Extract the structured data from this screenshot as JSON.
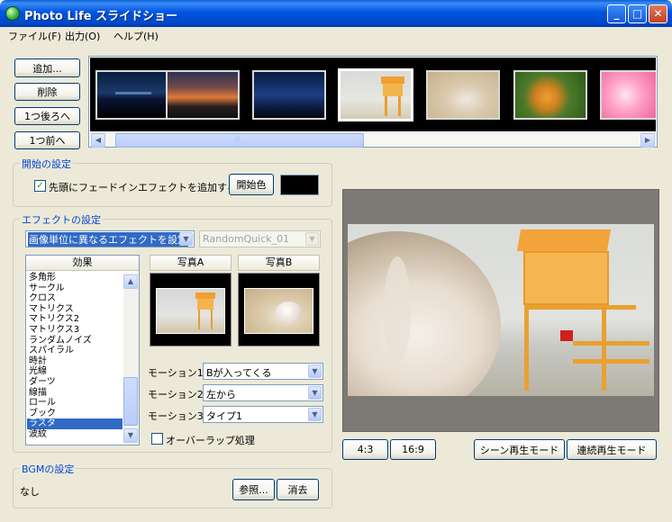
{
  "window": {
    "title": "Photo Life スライドショー",
    "min_label": "_",
    "max_label": "□",
    "close_label": "✕"
  },
  "menu": {
    "file": "ファイル(F)",
    "output": "出力(O)",
    "help": "ヘルプ(H)"
  },
  "side_buttons": {
    "add": "追加...",
    "delete": "削除",
    "move_back": "1つ後ろへ",
    "move_front": "1つ前へ"
  },
  "filmstrip": {
    "thumbnails": [
      {
        "name": "night-harbor"
      },
      {
        "name": "sunset-clouds"
      },
      {
        "name": "night-sky"
      },
      {
        "name": "lifeguard-tower",
        "selected": true
      },
      {
        "name": "seashell-sand"
      },
      {
        "name": "coconuts"
      },
      {
        "name": "hibiscus"
      }
    ],
    "scroll_left_icon": "scroll-left-arrow",
    "scroll_right_icon": "scroll-right-arrow",
    "grip": "⦙⦙⦙"
  },
  "start_settings": {
    "title": "開始の設定",
    "fade_in_checked": true,
    "fade_in_label": "先頭にフェードインエフェクトを追加する",
    "start_color_button": "開始色",
    "start_color": "#000000"
  },
  "effect_settings": {
    "title": "エフェクトの設定",
    "mode_value": "画像単位に異なるエフェクトを設定",
    "random_value": "RandomQuick_01",
    "list_header": "効果",
    "effects": [
      "多角形",
      "サークル",
      "クロス",
      "マトリクス",
      "マトリクス2",
      "マトリクス3",
      "ランダムノイズ",
      "スパイラル",
      "時計",
      "光線",
      "ダーツ",
      "線描",
      "ロール",
      "ブック",
      "ラスタ",
      "波紋"
    ],
    "selected_effect": "ラスタ",
    "photo_a_label": "写真A",
    "photo_b_label": "写真B",
    "motion1_label": "モーション1",
    "motion1_value": "Bが入ってくる",
    "motion2_label": "モーション2",
    "motion2_value": "左から",
    "motion3_label": "モーション3",
    "motion3_value": "タイプ1",
    "overlap_checked": false,
    "overlap_label": "オーバーラップ処理"
  },
  "bgm_settings": {
    "title": "BGMの設定",
    "value": "なし",
    "browse_button": "参照...",
    "clear_button": "消去"
  },
  "preview_controls": {
    "ratio_4_3": "4:3",
    "ratio_16_9": "16:9",
    "scene_play": "シーン再生モード",
    "continuous_play": "連続再生モード"
  },
  "colors": {
    "titlebar": "#0054e3",
    "window_bg": "#ece9d8",
    "group_title": "#0046d5",
    "selection": "#316ac5",
    "tower_orange": "#f0a030"
  }
}
